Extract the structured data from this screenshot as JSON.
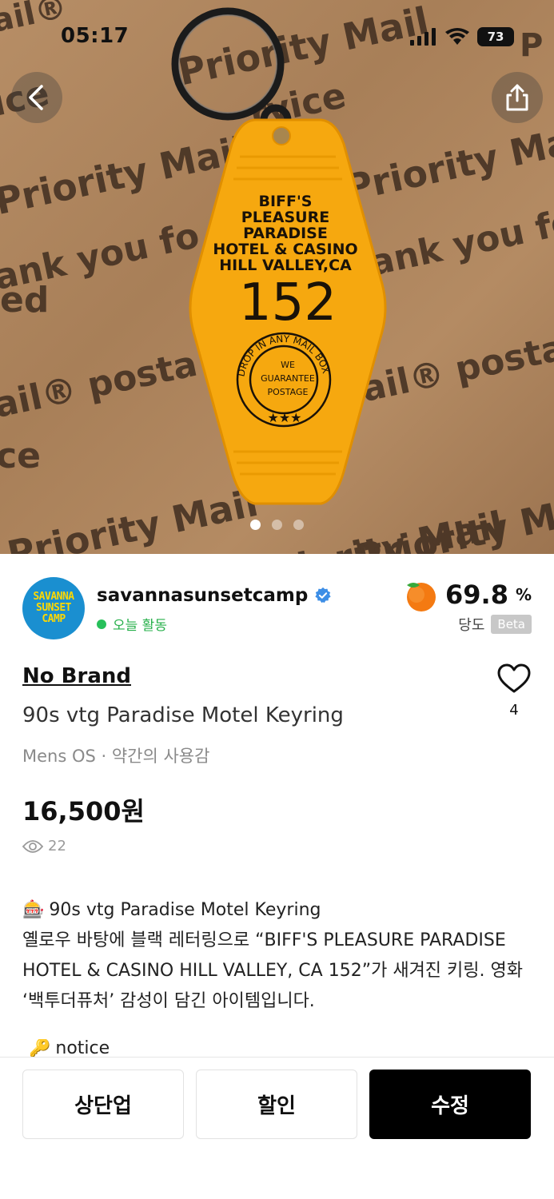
{
  "status_bar": {
    "time": "05:17",
    "battery": "73"
  },
  "hero": {
    "background_words": [
      "Priority Mail",
      "Priority Mail",
      "Priority Mai",
      "Priority Mail",
      "Priority Ma",
      "ank you fo",
      "ank you fo",
      "ail® posta",
      "ail® postag",
      "ice",
      "ice",
      "ed",
      "rvice",
      "sing Priority Mail",
      "ail®",
      "P"
    ],
    "keytag": {
      "line1": "BIFF'S",
      "line2": "PLEASURE",
      "line3": "PARADISE",
      "line4": "HOTEL & CASINO",
      "line5": "HILL VALLEY,CA",
      "number": "152",
      "seal_arc": "DROP IN ANY MAIL BOX",
      "seal_line1": "WE",
      "seal_line2": "GUARANTEE",
      "seal_line3": "POSTAGE",
      "seal_stars": "★★★"
    },
    "image_count": 3,
    "active_image": 0
  },
  "seller": {
    "avatar_lines": [
      "SAVANNA",
      "SUNSET",
      "CAMP"
    ],
    "name": "savannasunsetcamp",
    "activity": "오늘 활동",
    "sweetness_value": "69.8",
    "sweetness_unit": "%",
    "sweetness_label": "당도",
    "beta_label": "Beta"
  },
  "product": {
    "brand": "No Brand",
    "title": "90s vtg Paradise Motel Keyring",
    "meta": "Mens OS · 약간의 사용감",
    "price": "16,500원",
    "views": "22",
    "likes": "4"
  },
  "description": {
    "emoji": "🎰",
    "line1": "90s vtg Paradise Motel Keyring",
    "body": "옐로우 바탕에 블랙 레터링으로 “BIFF'S PLEASURE PARADISE HOTEL & CASINO HILL VALLEY, CA 152”가 새겨진 키링. 영화 ‘백투더퓨처’ 감성이 담긴 아이템입니다.",
    "notice_emoji": "🔑",
    "notice": "notice"
  },
  "actions": {
    "bump_label": "상단업",
    "discount_label": "할인",
    "edit_label": "수정"
  },
  "colors": {
    "keytag": "#f6a80f",
    "active_green": "#27b04b",
    "verified_blue": "#3d8ee6",
    "primary_button": "#000000"
  }
}
